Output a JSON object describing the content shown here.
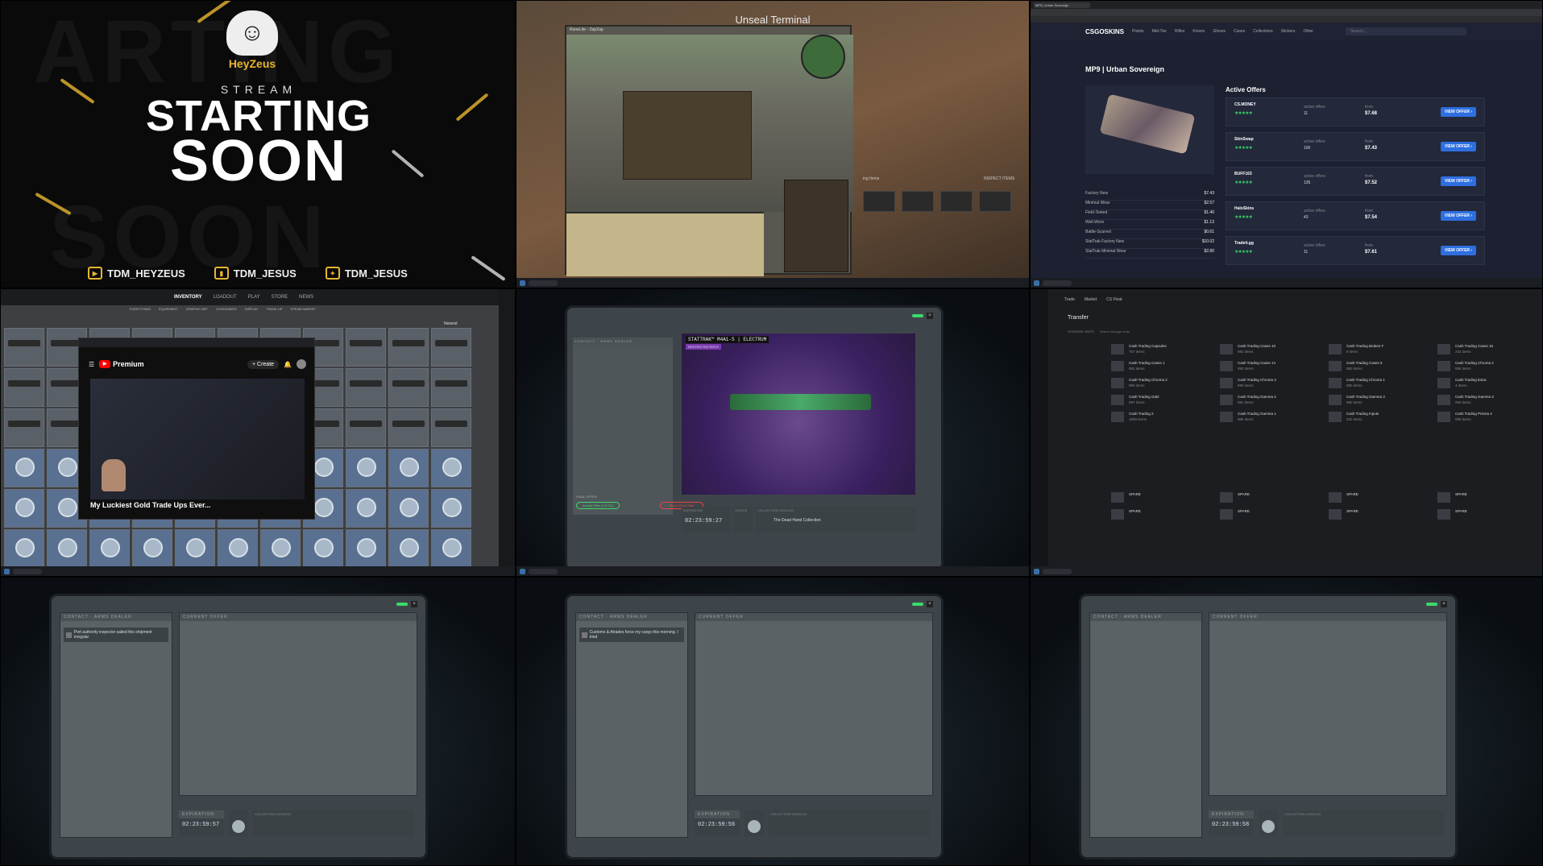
{
  "panel1": {
    "brand": "HeyZeus",
    "stream": "STREAM",
    "starting": "STARTING",
    "soon": "SOON",
    "bg_word_top": "ARTING",
    "bg_word_bottom": "SOON",
    "socials": [
      {
        "icon": "youtube-icon",
        "handle": "TDM_HEYZEUS"
      },
      {
        "icon": "twitch-icon",
        "handle": "TDM_JESUS"
      },
      {
        "icon": "twitter-icon",
        "handle": "TDM_JESUS"
      }
    ],
    "accent": "#e8b530"
  },
  "panel2": {
    "title": "Unseal Terminal",
    "window_title": "RuneLite - ZapZap",
    "inspect": "INSPECT ITEMS",
    "right_label": "ing Items"
  },
  "panel3": {
    "logo": "CSGOSKINS",
    "nav": [
      "Pistols",
      "Mid-Tier",
      "Rifles",
      "Knives",
      "Gloves",
      "Cases",
      "Collections",
      "Stickers",
      "Other"
    ],
    "search_placeholder": "Search...",
    "item_title": "MP9 | Urban Sovereign",
    "active_offers": "Active Offers",
    "promoted": "Promoted",
    "wears": [
      {
        "name": "Factory New",
        "price": "$7.43"
      },
      {
        "name": "Minimal Wear",
        "price": "$2.57"
      },
      {
        "name": "Field-Tested",
        "price": "$1.40"
      },
      {
        "name": "Well-Worn",
        "price": "$1.13"
      },
      {
        "name": "Battle-Scarred",
        "price": "$0.61"
      },
      {
        "name": "StatTrak Factory New",
        "price": "$10.02"
      },
      {
        "name": "StatTrak Minimal Wear",
        "price": "$2.80"
      }
    ],
    "offers": [
      {
        "name": "CS.MONEY",
        "active": "11",
        "price": "$7.68"
      },
      {
        "name": "SkinSwap",
        "active": "100",
        "price": "$7.43"
      },
      {
        "name": "BUFF163",
        "active": "135",
        "price": "$7.52"
      },
      {
        "name": "HaloSkins",
        "active": "43",
        "price": "$7.54"
      },
      {
        "name": "Tradeit.gg",
        "active": "11",
        "price": "$7.61"
      }
    ],
    "active_offers_label": "active offers",
    "from_label": "from",
    "view_offer": "VIEW OFFER ›",
    "accent": "#2e6fe0"
  },
  "panel4": {
    "nav": [
      "INVENTORY",
      "LOADOUT",
      "PLAY",
      "STORE",
      "NEWS"
    ],
    "subnav": [
      "EVERYTHING",
      "EQUIPMENT",
      "GRAPHIC ART",
      "CONTAINERS",
      "DISPLAY",
      "TRADE UP",
      "STEAM MARKET"
    ],
    "sort": "Newest",
    "youtube": {
      "premium": "Premium",
      "create": "+ Create",
      "video_title": "My Luckiest Gold Trade Ups Ever..."
    }
  },
  "panel5": {
    "contact": "CONTACT · ARMS DEALER",
    "current_offer": "CURRENT OFFER",
    "item_name": "STATTRAK™ M4A1-S | ELECTRUM",
    "item_rarity": "RESTRICTED RIFLE",
    "final_offer": "FINAL OFFER",
    "accept": "Accept Offer (4.5 Crt)",
    "reject": "Reject Final Offer",
    "expiration_label": "EXPIRATION",
    "expiration": "02:23:59:27",
    "status_label": "STATUS",
    "collection_label": "COLLECTION CATALOG",
    "collection": "The Dead Hand Collection"
  },
  "panel6": {
    "tabs": [
      "Trade",
      "Market",
      "CS Float"
    ],
    "title": "Transfer",
    "storage_label": "STORAGE UNITS",
    "storage_search": "Search storage units",
    "units": [
      {
        "name": "Cash Trading Capsules",
        "count": "757 items"
      },
      {
        "name": "Cash Trading Cases 1",
        "count": "981 items"
      },
      {
        "name": "Cash Trading Chroma 2",
        "count": "990 items"
      },
      {
        "name": "Cash Trading Gal2",
        "count": "997 items"
      },
      {
        "name": "Cash Trading 2",
        "count": "1000 items"
      },
      {
        "name": "Cash Trading Cases 10",
        "count": "981 items"
      },
      {
        "name": "Cash Trading Cases 14",
        "count": "993 items"
      },
      {
        "name": "Cash Trading Chroma 3",
        "count": "990 items"
      },
      {
        "name": "Cash Trading Gamma 2",
        "count": "991 items"
      },
      {
        "name": "Cash Trading Gamma 1",
        "count": "985 items"
      },
      {
        "name": "Cash Trading Broken F",
        "count": "8 items"
      },
      {
        "name": "Cash Trading Cases 5",
        "count": "850 items"
      },
      {
        "name": "Cash Trading Chroma 1",
        "count": "990 items"
      },
      {
        "name": "Cash Trading Gamma 3",
        "count": "990 items"
      },
      {
        "name": "Cash Trading Inputs",
        "count": "220 items"
      },
      {
        "name": "Cash Trading Cases 16",
        "count": "234 items"
      },
      {
        "name": "Cash Trading Chroma 2",
        "count": "995 items"
      },
      {
        "name": "Cash Trading Extra",
        "count": "4 items"
      },
      {
        "name": "Cash Trading Gamma 3",
        "count": "990 items"
      },
      {
        "name": "Cash Trading Prisma 4",
        "count": "998 items"
      }
    ],
    "spare": "SPARE"
  },
  "panel7": {
    "contact": "CONTACT · ARMS DEALER",
    "current_offer": "CURRENT OFFER",
    "message": "Port authority inspector sailed this shipment irregular",
    "expiration_label": "EXPIRATION",
    "expiration": "02:23:59:57",
    "status_label": "STATUS",
    "collection_label": "COLLECTION CATALOG"
  },
  "panel8": {
    "contact": "CONTACT · ARMS DEALER",
    "current_offer": "CURRENT OFFER",
    "message": "Customs & Atrades force my cargo this morning. I tried",
    "expiration_label": "EXPIRATION",
    "expiration": "02:23:59:56",
    "status_label": "STATUS",
    "collection_label": "COLLECTION CATALOG"
  },
  "panel9": {
    "contact": "CONTACT · ARMS DEALER",
    "current_offer": "CURRENT OFFER",
    "expiration_label": "EXPIRATION",
    "expiration": "02:23:59:58",
    "status_label": "STATUS",
    "collection_label": "COLLECTION CATALOG"
  }
}
